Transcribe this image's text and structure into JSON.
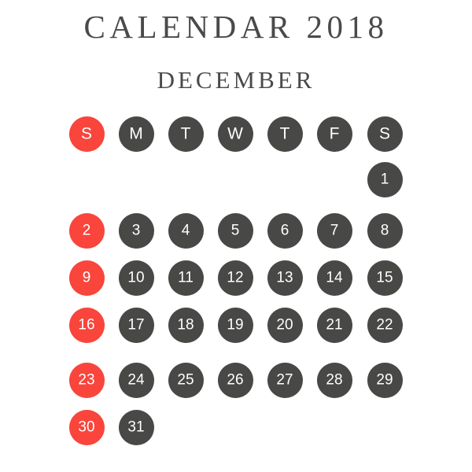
{
  "page": {
    "title": "CALENDAR 2018",
    "subtitle": "DECEMBER",
    "background_color": "#ffffff",
    "title_color": "#4a4a4a"
  },
  "colors": {
    "accent": "#f9453c",
    "normal": "#484846",
    "day_text": "#ffffff"
  },
  "weekdays": [
    {
      "label": "S",
      "accent": true
    },
    {
      "label": "M",
      "accent": false
    },
    {
      "label": "T",
      "accent": false
    },
    {
      "label": "W",
      "accent": false
    },
    {
      "label": "T",
      "accent": false
    },
    {
      "label": "F",
      "accent": false
    },
    {
      "label": "S",
      "accent": false
    }
  ],
  "weeks": [
    [
      {
        "label": "",
        "empty": true
      },
      {
        "label": "",
        "empty": true
      },
      {
        "label": "",
        "empty": true
      },
      {
        "label": "",
        "empty": true
      },
      {
        "label": "",
        "empty": true
      },
      {
        "label": "",
        "empty": true
      },
      {
        "label": "1",
        "accent": false
      }
    ],
    [
      {
        "label": "2",
        "accent": true
      },
      {
        "label": "3",
        "accent": false
      },
      {
        "label": "4",
        "accent": false
      },
      {
        "label": "5",
        "accent": false
      },
      {
        "label": "6",
        "accent": false
      },
      {
        "label": "7",
        "accent": false
      },
      {
        "label": "8",
        "accent": false
      }
    ],
    [
      {
        "label": "9",
        "accent": true
      },
      {
        "label": "10",
        "accent": false
      },
      {
        "label": "11",
        "accent": false
      },
      {
        "label": "12",
        "accent": false
      },
      {
        "label": "13",
        "accent": false
      },
      {
        "label": "14",
        "accent": false
      },
      {
        "label": "15",
        "accent": false
      }
    ],
    [
      {
        "label": "16",
        "accent": true
      },
      {
        "label": "17",
        "accent": false
      },
      {
        "label": "18",
        "accent": false
      },
      {
        "label": "19",
        "accent": false
      },
      {
        "label": "20",
        "accent": false
      },
      {
        "label": "21",
        "accent": false
      },
      {
        "label": "22",
        "accent": false
      }
    ],
    [
      {
        "label": "23",
        "accent": true
      },
      {
        "label": "24",
        "accent": false
      },
      {
        "label": "25",
        "accent": false
      },
      {
        "label": "26",
        "accent": false
      },
      {
        "label": "27",
        "accent": false
      },
      {
        "label": "28",
        "accent": false
      },
      {
        "label": "29",
        "accent": false
      }
    ],
    [
      {
        "label": "30",
        "accent": true
      },
      {
        "label": "31",
        "accent": false
      },
      {
        "label": "",
        "empty": true
      },
      {
        "label": "",
        "empty": true
      },
      {
        "label": "",
        "empty": true
      },
      {
        "label": "",
        "empty": true
      },
      {
        "label": "",
        "empty": true
      }
    ]
  ],
  "layout": {
    "col_centers": [
      110,
      173,
      236,
      299,
      362,
      425,
      489
    ],
    "weekday_row_center": 170,
    "week_row_centers": [
      228,
      293,
      353,
      413,
      483,
      543
    ]
  }
}
